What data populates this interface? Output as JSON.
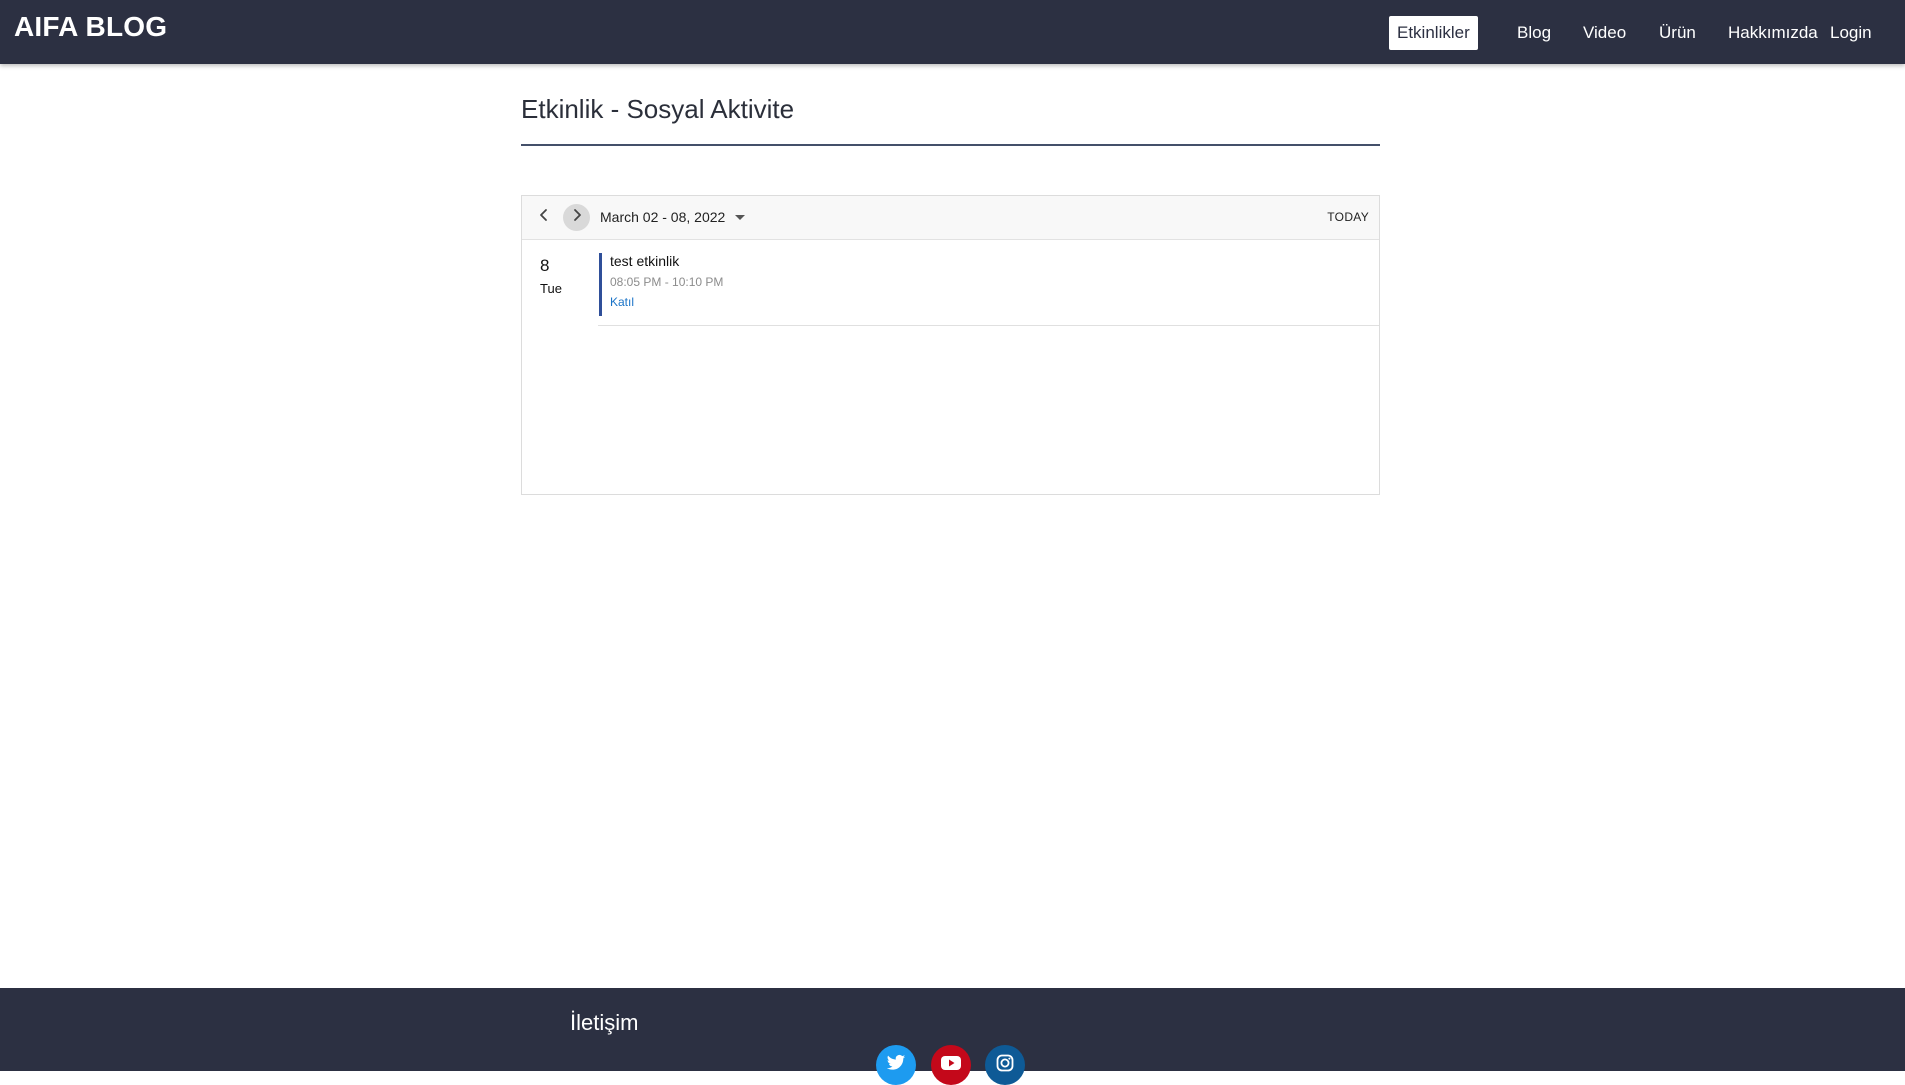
{
  "brand": "AIFA BLOG",
  "nav": {
    "etkinlikler": "Etkinlikler",
    "blog": "Blog",
    "video": "Video",
    "urun": "Ürün",
    "hakkimizda": "Hakkımızda",
    "login": "Login"
  },
  "page_title": "Etkinlik - Sosyal Aktivite",
  "calendar": {
    "range_label": "March 02 - 08, 2022",
    "today_label": "TODAY",
    "day": {
      "number": "8",
      "weekday": "Tue"
    },
    "event": {
      "title": "test etkinlik",
      "time": "08:05 PM - 10:10 PM",
      "action_label": "Katıl",
      "accent_color": "#2f4f99"
    }
  },
  "footer": {
    "title": "İletişim",
    "social": [
      {
        "icon": "twitter-icon",
        "color": "#1d9bf0"
      },
      {
        "icon": "youtube-icon",
        "color": "#c4081a"
      },
      {
        "icon": "instagram-icon",
        "color": "#0e5a96"
      }
    ]
  },
  "colors": {
    "navbar_bg": "#2c3042",
    "link": "#1a73c7"
  }
}
